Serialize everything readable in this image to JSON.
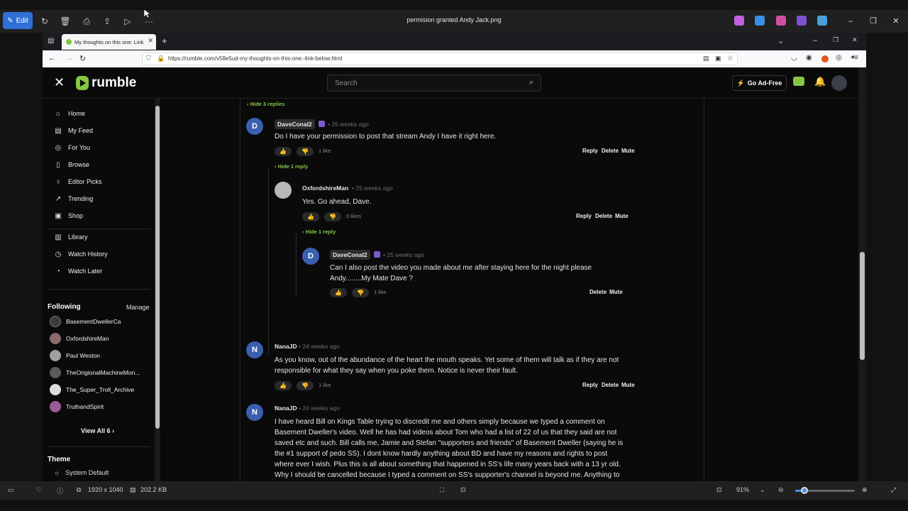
{
  "viewer": {
    "edit_label": "Edit",
    "file_title": "permision granted Andy Jack.png",
    "dimensions": "1920 x 1040",
    "file_size": "202.2 KB",
    "zoom_label": "91%",
    "zoom_fraction": 0.15
  },
  "browser": {
    "tab_title": "My thoughts on this one. Link",
    "url": "https://rumble.com/v58e5ud-my-thoughts-on-this-one.-link-below.html"
  },
  "site": {
    "logo_text": "rumble",
    "search_placeholder": "Search",
    "go_adfree": "Go Ad-Free"
  },
  "sidebar": {
    "nav": [
      {
        "label": "Home",
        "icon": "home-icon"
      },
      {
        "label": "My Feed",
        "icon": "feed-icon"
      },
      {
        "label": "For You",
        "icon": "target-icon"
      },
      {
        "label": "Browse",
        "icon": "browse-icon"
      },
      {
        "label": "Editor Picks",
        "icon": "award-icon"
      },
      {
        "label": "Trending",
        "icon": "trending-icon"
      },
      {
        "label": "Shop",
        "icon": "shop-icon"
      }
    ],
    "library": [
      {
        "label": "Library",
        "icon": "library-icon"
      },
      {
        "label": "Watch History",
        "icon": "history-icon"
      },
      {
        "label": "Watch Later",
        "icon": "clock-icon"
      }
    ],
    "following_title": "Following",
    "manage_label": "Manage",
    "following": [
      "BasementDwellerCa",
      "OxfordshireMan",
      "Paul Weston",
      "TheOrigionalMachineMon...",
      "The_Super_Troll_Archive",
      "TruthandSpirit"
    ],
    "view_all": "View All 6",
    "theme_title": "Theme",
    "theme_option": "System Default"
  },
  "comments": {
    "hide_top": "Hide 3 replies",
    "c1": {
      "user": "DaveConal2",
      "initial": "D",
      "when": "25 weeks ago",
      "text": "Do I have your permission to post that stream Andy I have it right here.",
      "likes": "1 like",
      "reply": "Reply",
      "delete": "Delete",
      "mute": "Mute",
      "hide": "Hide 1 reply"
    },
    "c2": {
      "user": "OxfordshireMan",
      "when": "25 weeks ago",
      "text": "Yes. Go ahead, Dave.",
      "likes": "0 likes",
      "reply": "Reply",
      "delete": "Delete",
      "mute": "Mute",
      "hide": "Hide 1 reply"
    },
    "c3": {
      "user": "DaveConal2",
      "initial": "D",
      "when": "25 weeks ago",
      "text1": "Can I also post the video you made about me after staying here for the night please",
      "text2": "Andy........My Mate Dave ?",
      "likes": "1 like",
      "delete": "Delete",
      "mute": "Mute"
    },
    "c4": {
      "user": "NanaJD",
      "initial": "N",
      "when": "24 weeks ago",
      "text1": "As you know, out of the abundance of the heart the mouth speaks. Yet some of them will talk as if they are not",
      "text2": "responsible for what they say when you poke them. Notice is never their fault.",
      "likes": "1 like",
      "reply": "Reply",
      "delete": "Delete",
      "mute": "Mute"
    },
    "c5": {
      "user": "NanaJD",
      "initial": "N",
      "when": "24 weeks ago",
      "lines": [
        "I have heard Bill on Kings Table trying to discredit me and others simply because we typed a comment on",
        "Basement Dweller's video. Well he has had videos about Tom who had a list of 22 of us that they said are not",
        "saved etc and such. Bill calls me, Jamie and Stefan \"supporters and friends\" of Basement Dweller (saying he is",
        "the #1 support of pedo SS). I dont know hardly anything about BD and have my reasons and rights to post",
        "where ever I wish. Plus this is all about something that happened in SS's life many years back with a 13 yr old.",
        "Why I should be cancelled because I typed a comment on SS's supporter's channel is beyond me. Anything to"
      ]
    }
  }
}
